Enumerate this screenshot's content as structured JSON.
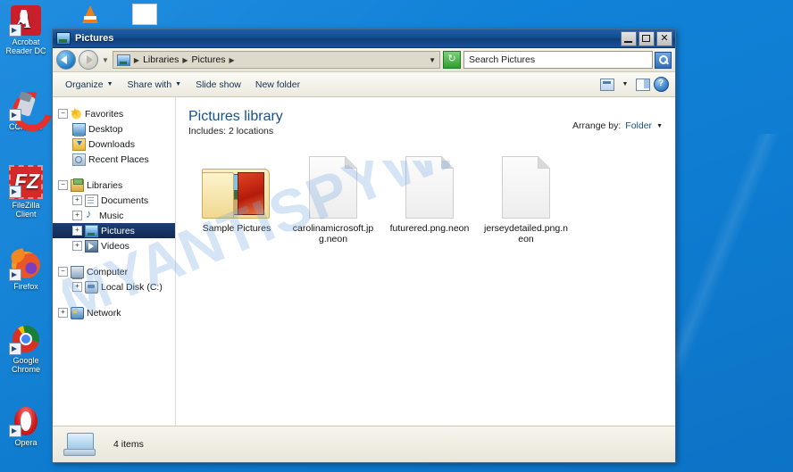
{
  "desktop": {
    "icons": [
      {
        "name": "acrobat",
        "label": "Acrobat\nReader DC"
      },
      {
        "name": "ccleaner",
        "label": "CCleaner"
      },
      {
        "name": "filezilla",
        "label": "FileZilla Client"
      },
      {
        "name": "firefox",
        "label": "Firefox"
      },
      {
        "name": "chrome",
        "label": "Google\nChrome"
      },
      {
        "name": "opera",
        "label": "Opera"
      }
    ],
    "background_color": "#1082d8"
  },
  "watermark": {
    "text": "MYANTISPYWARE.C",
    "color": "#78aae1"
  },
  "window": {
    "title": "Pictures",
    "title_icon": "pictures-library-icon",
    "controls": {
      "minimize": "Minimize",
      "maximize": "Maximize",
      "close": "Close"
    },
    "address_bar": {
      "back": "Back",
      "forward": "Forward",
      "history_dropdown": "Recent pages",
      "crumbs": [
        "Libraries",
        "Pictures"
      ],
      "crumb_separator": "▸",
      "refresh": "Refresh",
      "search_placeholder": "Search Pictures",
      "search_value": "",
      "search_button": "search-icon"
    },
    "command_bar": {
      "items": [
        {
          "label": "Organize",
          "has_caret": true
        },
        {
          "label": "Share with",
          "has_caret": true
        },
        {
          "label": "Slide show",
          "has_caret": false
        },
        {
          "label": "New folder",
          "has_caret": false
        }
      ],
      "view_button": "change-view-icon",
      "view_caret": "▼",
      "preview_pane": "preview-pane-icon",
      "help": "?"
    },
    "nav_pane": {
      "groups": [
        {
          "label": "Favorites",
          "icon": "star-icon",
          "expander": "−",
          "items": [
            {
              "label": "Desktop",
              "icon": "desktop-icon",
              "expander": ""
            },
            {
              "label": "Downloads",
              "icon": "downloads-icon",
              "expander": ""
            },
            {
              "label": "Recent Places",
              "icon": "recent-places-icon",
              "expander": ""
            }
          ]
        },
        {
          "label": "Libraries",
          "icon": "libraries-icon",
          "expander": "−",
          "items": [
            {
              "label": "Documents",
              "icon": "documents-icon",
              "expander": "+"
            },
            {
              "label": "Music",
              "icon": "music-icon",
              "expander": "+"
            },
            {
              "label": "Pictures",
              "icon": "pictures-icon",
              "expander": "+",
              "selected": true
            },
            {
              "label": "Videos",
              "icon": "videos-icon",
              "expander": "+"
            }
          ]
        },
        {
          "label": "Computer",
          "icon": "computer-icon",
          "expander": "−",
          "items": [
            {
              "label": "Local Disk (C:)",
              "icon": "disk-icon",
              "expander": "+"
            }
          ]
        },
        {
          "label": "Network",
          "icon": "network-icon",
          "expander": "+",
          "items": []
        }
      ]
    },
    "library_header": {
      "title": "Pictures library",
      "subtitle": "Includes:  2 locations",
      "arrange_label": "Arrange by:",
      "arrange_value": "Folder",
      "arrange_caret": "▼"
    },
    "files": [
      {
        "name": "Sample Pictures",
        "type": "folder"
      },
      {
        "name": "carolinamicrosoft.jpg.neon",
        "type": "file"
      },
      {
        "name": "futurered.png.neon",
        "type": "file"
      },
      {
        "name": "jerseydetailed.png.neon",
        "type": "file"
      }
    ],
    "status_bar": {
      "icon": "computer-icon",
      "text": "4 items"
    }
  }
}
